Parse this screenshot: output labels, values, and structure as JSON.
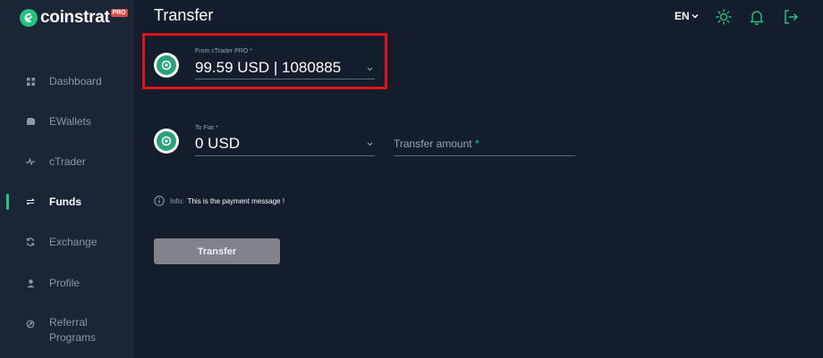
{
  "brand": {
    "name": "coinstrat",
    "badge": "PRO"
  },
  "sidebar": {
    "items": [
      {
        "label": "Dashboard",
        "icon": "grid-icon"
      },
      {
        "label": "EWallets",
        "icon": "wallet-icon"
      },
      {
        "label": "cTrader",
        "icon": "pulse-icon"
      },
      {
        "label": "Funds",
        "icon": "transfer-arrows-icon",
        "active": true
      },
      {
        "label": "Exchange",
        "icon": "refresh-icon"
      },
      {
        "label": "Profile",
        "icon": "user-icon"
      },
      {
        "label_line1": "Referral",
        "label_line2": "Programs",
        "icon": "referral-icon"
      }
    ]
  },
  "header": {
    "title": "Transfer",
    "language": "EN",
    "icons": [
      "sun-icon",
      "bell-icon",
      "logout-icon"
    ]
  },
  "form": {
    "from": {
      "label": "From cTrader PRO *",
      "value": "99.59 USD | 1080885"
    },
    "to": {
      "label": "To Fiat *",
      "value": "0 USD"
    },
    "amount": {
      "placeholder": "Transfer amount",
      "required_mark": "*"
    },
    "info": {
      "prefix": "Info:",
      "message": "This is the payment message !"
    },
    "submit_label": "Transfer"
  },
  "colors": {
    "accent": "#26c281",
    "highlight": "#e3121a",
    "background": "#131d2b",
    "sidebar": "#1a2636",
    "button_disabled": "#808389"
  }
}
